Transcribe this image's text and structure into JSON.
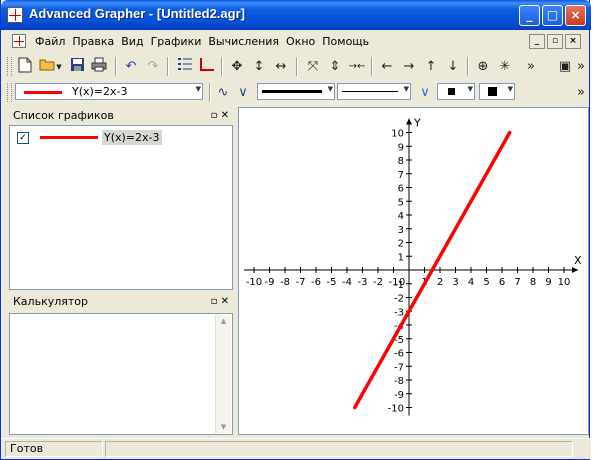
{
  "window": {
    "title": "Advanced Grapher - [Untitled2.agr]",
    "minimize_label": "_",
    "maximize_label": "□",
    "close_label": "×"
  },
  "menu": {
    "items": [
      "Файл",
      "Правка",
      "Вид",
      "Графики",
      "Вычисления",
      "Окно",
      "Помощь"
    ]
  },
  "formatbar": {
    "graph_combo_value": "Y(x)=2x-3",
    "line_color": "#ff0000"
  },
  "graph_list": {
    "title": "Список графиков",
    "items": [
      {
        "label": "Y(x)=2x-3",
        "checked": true,
        "color": "#ff0000"
      }
    ]
  },
  "calculator": {
    "title": "Калькулятор"
  },
  "status": {
    "text": "Готов"
  },
  "chart_data": {
    "type": "line",
    "xlabel": "X",
    "ylabel": "Y",
    "xlim": [
      -10,
      10
    ],
    "ylim": [
      -10,
      10
    ],
    "x_ticks": [
      -10,
      -9,
      -8,
      -7,
      -6,
      -5,
      -4,
      -3,
      -2,
      -1,
      0,
      1,
      2,
      3,
      4,
      5,
      6,
      7,
      8,
      9,
      10
    ],
    "y_ticks": [
      -10,
      -9,
      -8,
      -7,
      -6,
      -5,
      -4,
      -3,
      -2,
      -1,
      1,
      2,
      3,
      4,
      5,
      6,
      7,
      8,
      9,
      10
    ],
    "series": [
      {
        "name": "Y(x)=2x-3",
        "x": [
          -3.5,
          6.5
        ],
        "y": [
          -10,
          10
        ],
        "color": "#ff0000"
      }
    ],
    "grid": false
  }
}
